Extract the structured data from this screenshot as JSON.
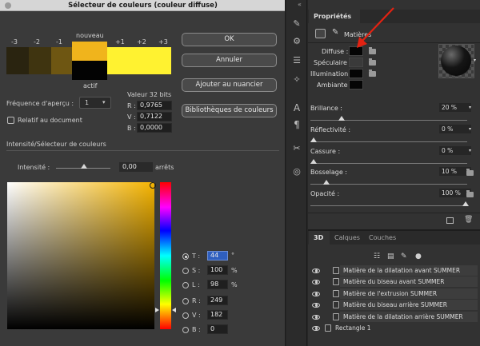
{
  "dialog": {
    "title": "Sélecteur de couleurs (couleur diffuse)",
    "swatch_labels": [
      "-3",
      "-2",
      "-1",
      "nouveau",
      "+1",
      "+2",
      "+3"
    ],
    "swatch_colors": [
      "#2a2410",
      "#3f3410",
      "#6e5612",
      "#f0b41c",
      "#fff230",
      "#fff230",
      "#fff230"
    ],
    "current_label": "actif",
    "buttons": {
      "ok": "OK",
      "cancel": "Annuler",
      "add_swatch": "Ajouter au nuancier",
      "libraries": "Bibliothèques de couleurs"
    },
    "preview_freq_label": "Fréquence d'aperçu :",
    "preview_freq_value": "1",
    "relative_label": "Relatif au document",
    "value32_title": "Valeur 32 bits",
    "r_label": "R :",
    "r_value": "0,9765",
    "v_label": "V :",
    "v_value": "0,7122",
    "b_label": "B :",
    "b_value": "0,0000",
    "intensity_section": "Intensité/Sélecteur de couleurs",
    "intensity_label": "Intensité :",
    "intensity_value": "0,00",
    "intensity_unit": "arrêts",
    "hsb": [
      {
        "label": "T :",
        "value": "44",
        "unit": "°",
        "selected": true
      },
      {
        "label": "S :",
        "value": "100",
        "unit": "%",
        "selected": false
      },
      {
        "label": "L :",
        "value": "98",
        "unit": "%",
        "selected": false
      }
    ],
    "rgb": [
      {
        "label": "R :",
        "value": "249"
      },
      {
        "label": "V :",
        "value": "182"
      },
      {
        "label": "B :",
        "value": "0"
      }
    ],
    "hue_color": "#f5b400"
  },
  "props": {
    "collapse": "«",
    "title": "Propriétés",
    "materials_label": "Matières",
    "channels": [
      {
        "label": "Diffuse :",
        "color": "#050505"
      },
      {
        "label": "Spéculaire :",
        "color": "#3a3a3a"
      },
      {
        "label": "Illumination :",
        "color": "#050505"
      },
      {
        "label": "Ambiante :",
        "color": "#050505"
      }
    ],
    "sliders": [
      {
        "label": "Brillance :",
        "value": "20 %",
        "level": 0.2
      },
      {
        "label": "Réflectivité :",
        "value": "0 %",
        "level": 0
      },
      {
        "label": "Cassure :",
        "value": "0 %",
        "level": 0
      },
      {
        "label": "Bosselage :",
        "value": "10 %",
        "level": 0.1
      },
      {
        "label": "Opacité :",
        "value": "100 %",
        "level": 1.0
      }
    ]
  },
  "panel3d": {
    "tabs": [
      "3D",
      "Calques",
      "Couches"
    ],
    "layers": [
      "Matière de la dilatation avant SUMMER",
      "Matière du biseau avant SUMMER",
      "Matière de l'extrusion SUMMER",
      "Matière du biseau arrière SUMMER",
      "Matière de la dilatation arrière SUMMER",
      "Rectangle 1"
    ]
  },
  "colors": {
    "accent": "#2f5fbf",
    "arrow": "#e32212"
  }
}
